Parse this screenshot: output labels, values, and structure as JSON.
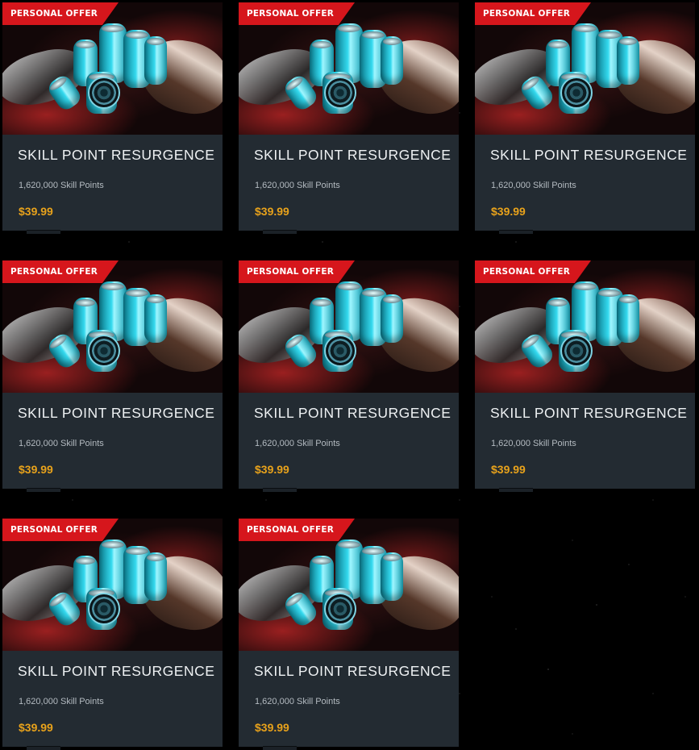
{
  "offers": [
    {
      "badge": "PERSONAL OFFER",
      "title": "SKILL POINT RESURGENCE",
      "description": "1,620,000 Skill Points",
      "price": "$39.99",
      "image": "skill-point-canisters-and-ships"
    },
    {
      "badge": "PERSONAL OFFER",
      "title": "SKILL POINT RESURGENCE",
      "description": "1,620,000 Skill Points",
      "price": "$39.99",
      "image": "skill-point-canisters-and-ships"
    },
    {
      "badge": "PERSONAL OFFER",
      "title": "SKILL POINT RESURGENCE",
      "description": "1,620,000 Skill Points",
      "price": "$39.99",
      "image": "skill-point-canisters-and-ships"
    },
    {
      "badge": "PERSONAL OFFER",
      "title": "SKILL POINT RESURGENCE",
      "description": "1,620,000 Skill Points",
      "price": "$39.99",
      "image": "skill-point-canisters-and-ships"
    },
    {
      "badge": "PERSONAL OFFER",
      "title": "SKILL POINT RESURGENCE",
      "description": "1,620,000 Skill Points",
      "price": "$39.99",
      "image": "skill-point-canisters-and-ships"
    },
    {
      "badge": "PERSONAL OFFER",
      "title": "SKILL POINT RESURGENCE",
      "description": "1,620,000 Skill Points",
      "price": "$39.99",
      "image": "skill-point-canisters-and-ships"
    },
    {
      "badge": "PERSONAL OFFER",
      "title": "SKILL POINT RESURGENCE",
      "description": "1,620,000 Skill Points",
      "price": "$39.99",
      "image": "skill-point-canisters-and-ships"
    },
    {
      "badge": "PERSONAL OFFER",
      "title": "SKILL POINT RESURGENCE",
      "description": "1,620,000 Skill Points",
      "price": "$39.99",
      "image": "skill-point-canisters-and-ships"
    }
  ],
  "colors": {
    "badge": "#d6161c",
    "card_background": "#232b32",
    "price": "#e8a21b",
    "title": "#eef1f3",
    "description": "#b4bbc1",
    "page_background": "#000000"
  }
}
